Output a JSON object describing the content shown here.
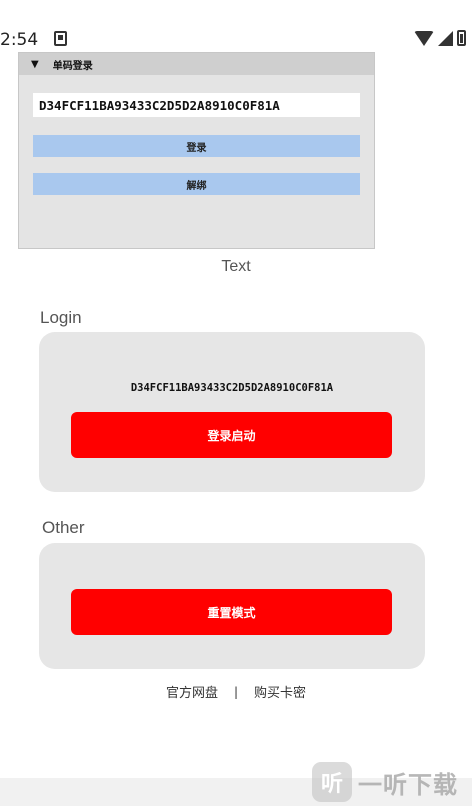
{
  "status_bar": {
    "time": "2:54",
    "icons": [
      "notification-icon",
      "wifi-icon",
      "signal-icon",
      "battery-icon"
    ]
  },
  "float_panel": {
    "header": "单码登录",
    "code_value": "D34FCF11BA93433C2D5D2A8910C0F81A",
    "login_label": "登录",
    "unbind_label": "解绑"
  },
  "text_label": "Text",
  "login_section": {
    "title": "Login",
    "code": "D34FCF11BA93433C2D5D2A8910C0F81A",
    "button_label": "登录启动"
  },
  "other_section": {
    "title": "Other",
    "button_label": "重置模式"
  },
  "links": {
    "official_disk": "官方网盘",
    "separator": "|",
    "buy_key": "购买卡密"
  },
  "watermark": {
    "glyph": "听",
    "text": "一听下载"
  },
  "colors": {
    "accent_red": "#ff0000",
    "float_button_blue": "#a9c8ee",
    "card_gray": "#e6e6e6"
  }
}
